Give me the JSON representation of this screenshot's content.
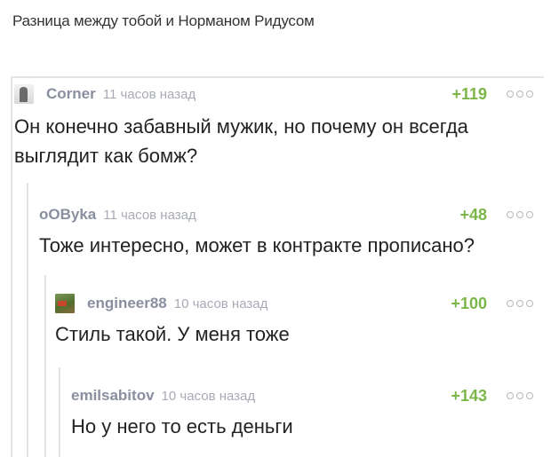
{
  "page": {
    "title": "Разница между тобой и Норманом Ридусом"
  },
  "comments": [
    {
      "author": "Corner",
      "time": "11 часов назад",
      "rating": "+119",
      "text": "Он конечно забавный мужик, но почему он всегда выглядит как бомж?",
      "avatar": "corner-avatar"
    },
    {
      "author": "oOByka",
      "time": "11 часов назад",
      "rating": "+48",
      "text": "Тоже интересно, может в контракте прописано?",
      "avatar": null
    },
    {
      "author": "engineer88",
      "time": "10 часов назад",
      "rating": "+100",
      "text": "Стиль такой. У меня тоже",
      "avatar": "engineer-avatar"
    },
    {
      "author": "emilsabitov",
      "time": "10 часов назад",
      "rating": "+143",
      "text": "Но у него то есть деньги",
      "avatar": null
    }
  ],
  "colors": {
    "rating_positive": "#7bb648",
    "author": "#8a8fa0",
    "time": "#a8abb5",
    "thread_line": "#e4e4e4"
  },
  "icons": {
    "more": "more-dots-icon"
  }
}
